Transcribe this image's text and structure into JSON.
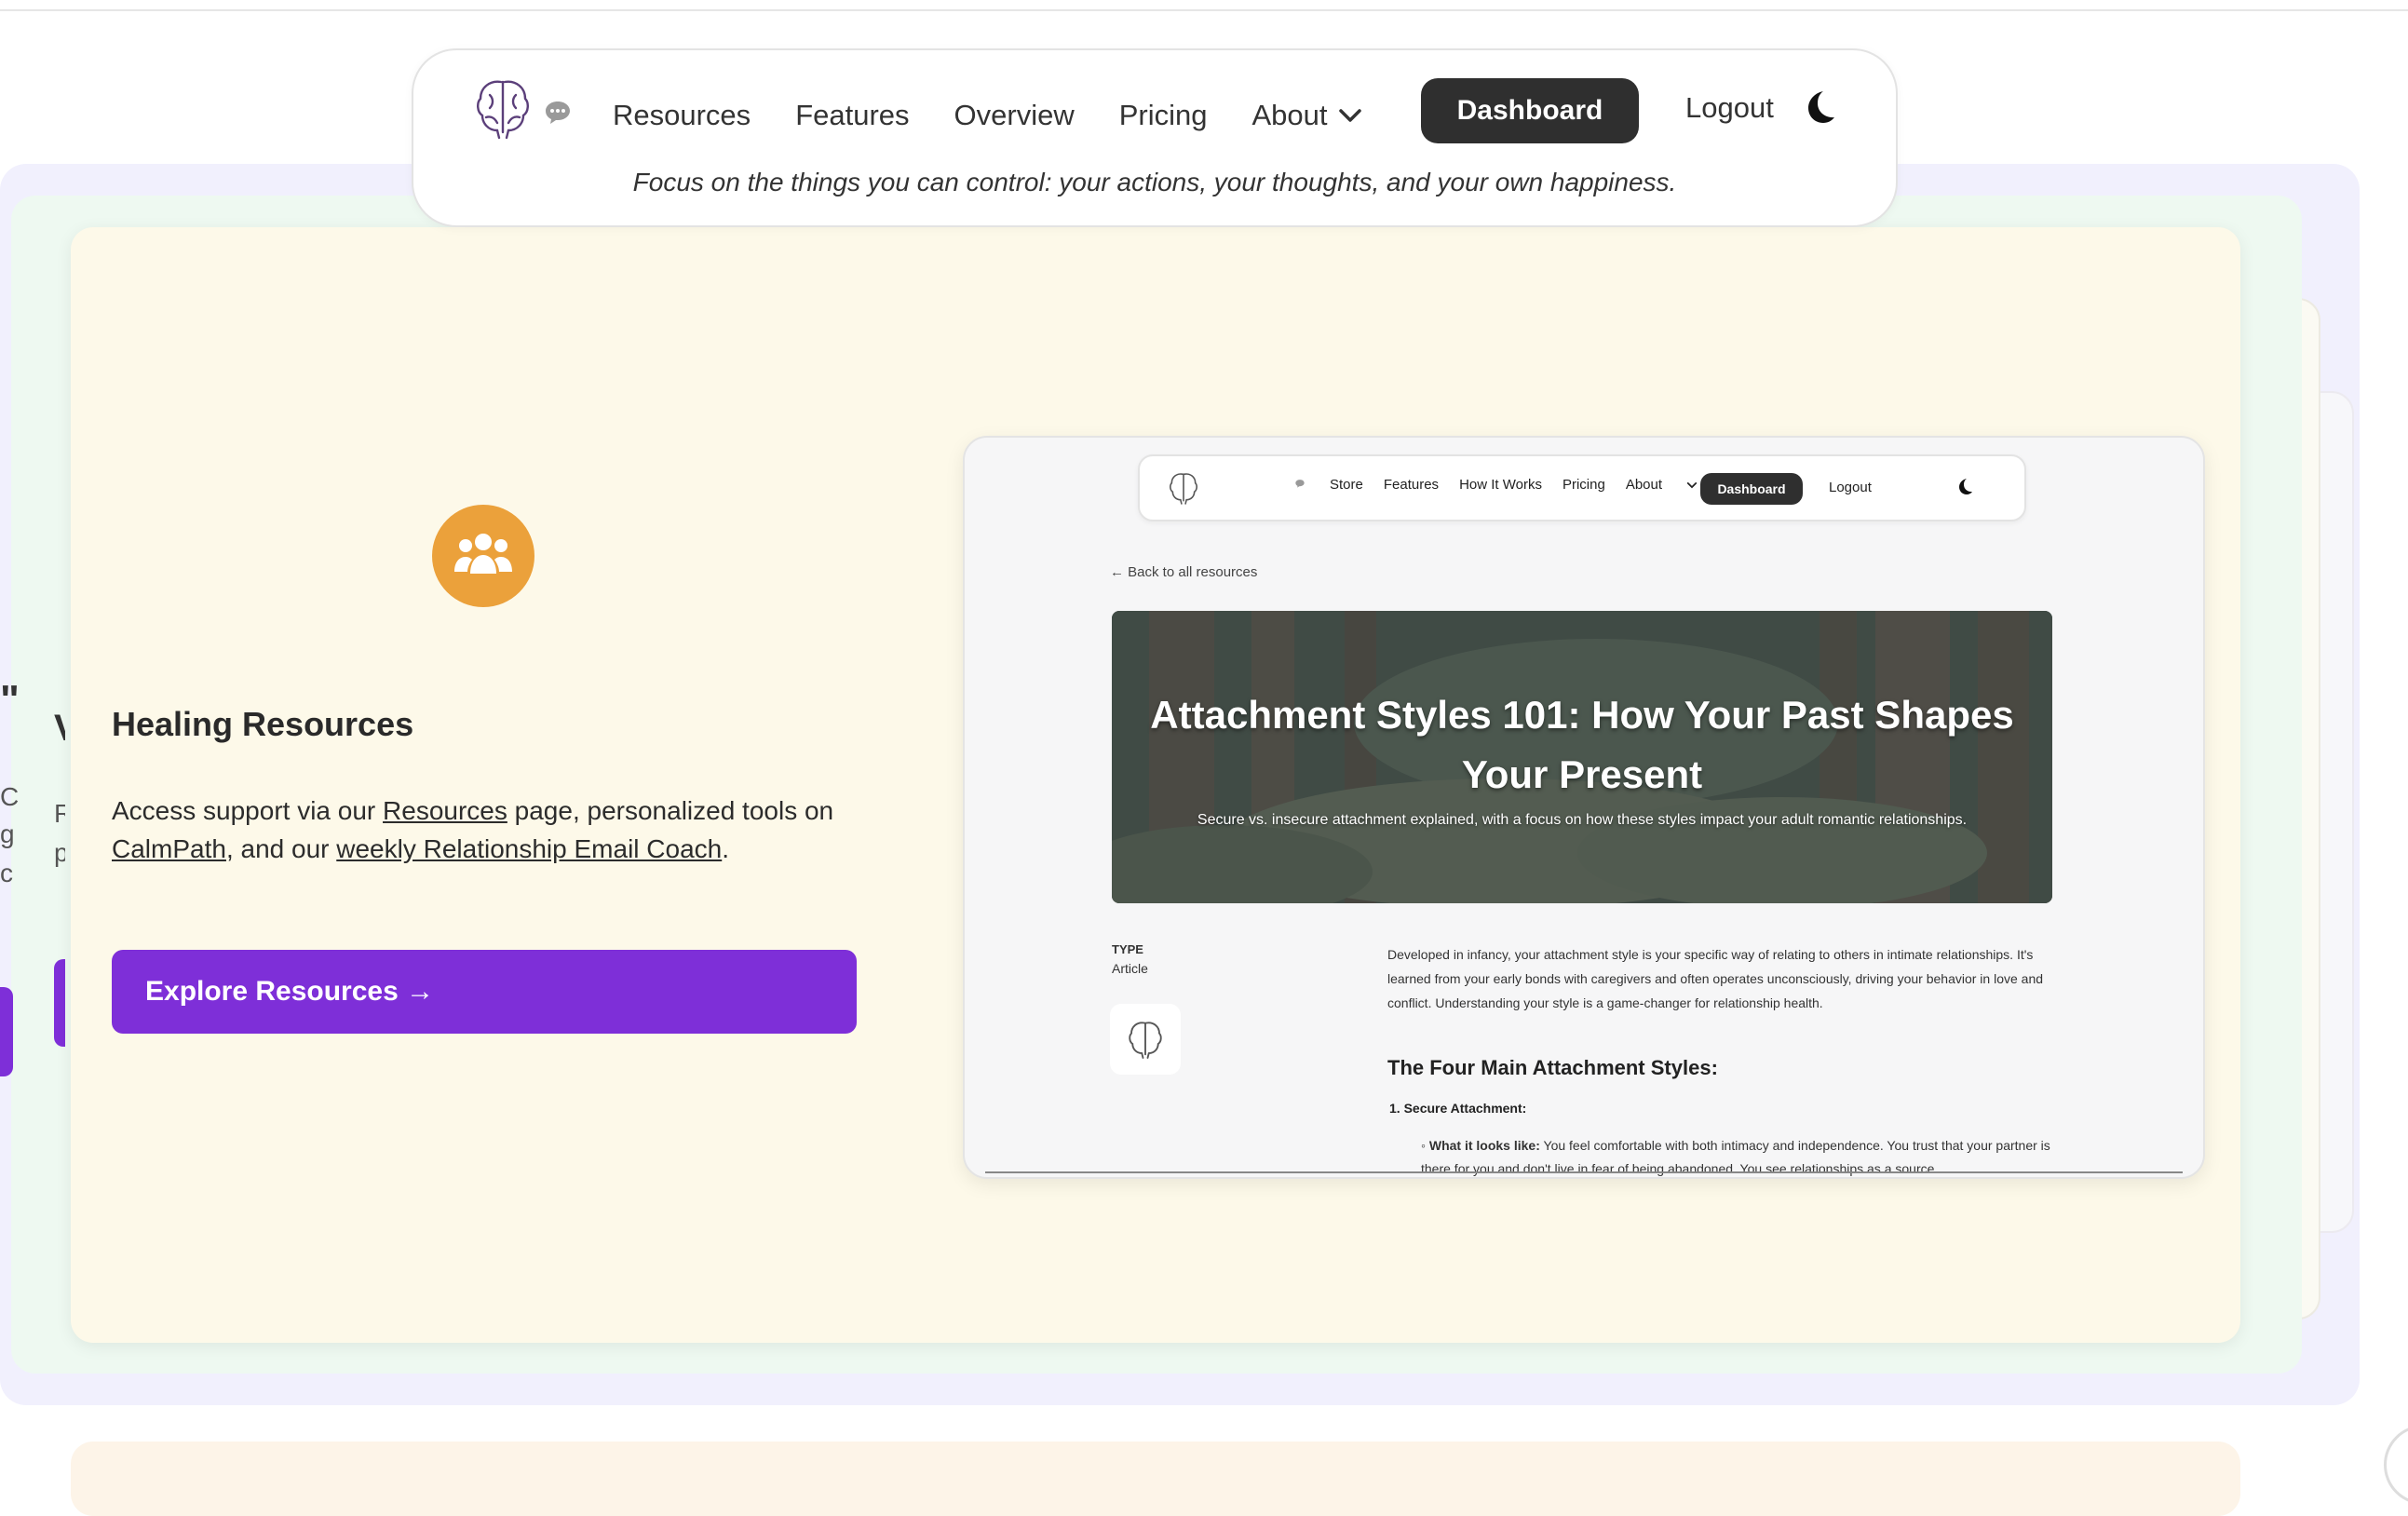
{
  "nav": {
    "links": [
      "Resources",
      "Features",
      "Overview",
      "Pricing"
    ],
    "about_label": "About",
    "dashboard_label": "Dashboard",
    "logout_label": "Logout",
    "quote": "Focus on the things you can control: your actions, your thoughts, and your own happiness."
  },
  "peek": {
    "quote_mark": "\"",
    "heading_letter": "V",
    "lines": [
      "C",
      "R",
      "g",
      "p",
      "c"
    ]
  },
  "feature": {
    "title": "Healing Resources",
    "desc_pre": "Access support via our ",
    "desc_link1": "Resources",
    "desc_mid1": " page, personalized tools on ",
    "desc_link2": "CalmPath",
    "desc_mid2": ", and our ",
    "desc_link3": "weekly Relationship Email Coach",
    "desc_post": ".",
    "button_label": "Explore Resources →"
  },
  "preview": {
    "nav_links": [
      "Store",
      "Features",
      "How It Works",
      "Pricing"
    ],
    "about_label": "About",
    "dashboard_label": "Dashboard",
    "logout_label": "Logout",
    "back_link": "Back to all resources",
    "hero_title": "Attachment Styles 101: How Your Past Shapes Your Present",
    "hero_subtitle": "Secure vs. insecure attachment explained, with a focus on how these styles impact your adult romantic relationships.",
    "type_label": "TYPE",
    "type_value": "Article",
    "body": "Developed in infancy, your attachment style is your specific way of relating to others in intimate relationships. It's learned from your early bonds with caregivers and often operates unconsciously, driving your behavior in love and conflict. Understanding your style is a game-changer for relationship health.",
    "section_heading": "The Four Main Attachment Styles:",
    "list_item_1": "1. Secure Attachment:",
    "sub_item_label": "What it looks like:",
    "sub_item_text": " You feel comfortable with both intimacy and independence. You trust that your partner is there for you and don't live in fear of being abandoned. You see relationships as a source"
  },
  "colors": {
    "accent_purple": "#7e2fd8",
    "icon_orange": "#eba13b",
    "card_cream": "#fdf9e9",
    "dark_button": "#2f2f2f"
  },
  "icons": [
    "brain-logo-icon",
    "chat-bubble-icon",
    "chevron-down-icon",
    "moon-icon",
    "people-group-icon",
    "arrow-left-icon"
  ]
}
